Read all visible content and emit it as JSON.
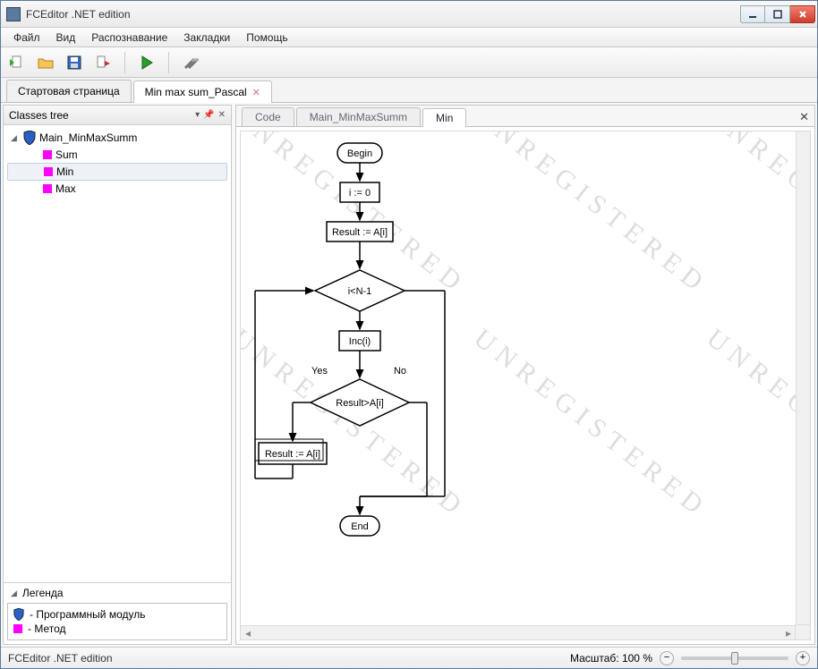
{
  "title": "FCEditor .NET edition",
  "menu": [
    "Файл",
    "Вид",
    "Распознавание",
    "Закладки",
    "Помощь"
  ],
  "toolbar_icons": [
    "new-file",
    "open-folder",
    "save",
    "export",
    "run",
    "settings"
  ],
  "doc_tabs": [
    {
      "label": "Стартовая страница",
      "active": false,
      "closable": false
    },
    {
      "label": "Min max sum_Pascal",
      "active": true,
      "closable": true
    }
  ],
  "sidebar": {
    "title": "Classes tree",
    "root": "Main_MinMaxSumm",
    "children": [
      "Sum",
      "Min",
      "Max"
    ],
    "selected": 1
  },
  "legend": {
    "title": "Легенда",
    "items": [
      {
        "icon": "shield",
        "text": "- Программный модуль"
      },
      {
        "icon": "pink",
        "text": "- Метод"
      }
    ]
  },
  "content_tabs": [
    {
      "label": "Code",
      "active": false
    },
    {
      "label": "Main_MinMaxSumm",
      "active": false
    },
    {
      "label": "Min",
      "active": true
    }
  ],
  "watermark_text": "UNREGISTERED",
  "flowchart": {
    "begin": "Begin",
    "step1": "i := 0",
    "step2": "Result := A[i]",
    "cond1": "i<N-1",
    "step3": "Inc(i)",
    "yes": "Yes",
    "no": "No",
    "cond2": "Result>A[i]",
    "step4": "Result := A[i]",
    "end": "End"
  },
  "status": {
    "left": "FCEditor .NET edition",
    "zoom_label": "Масштаб: 100 %"
  }
}
